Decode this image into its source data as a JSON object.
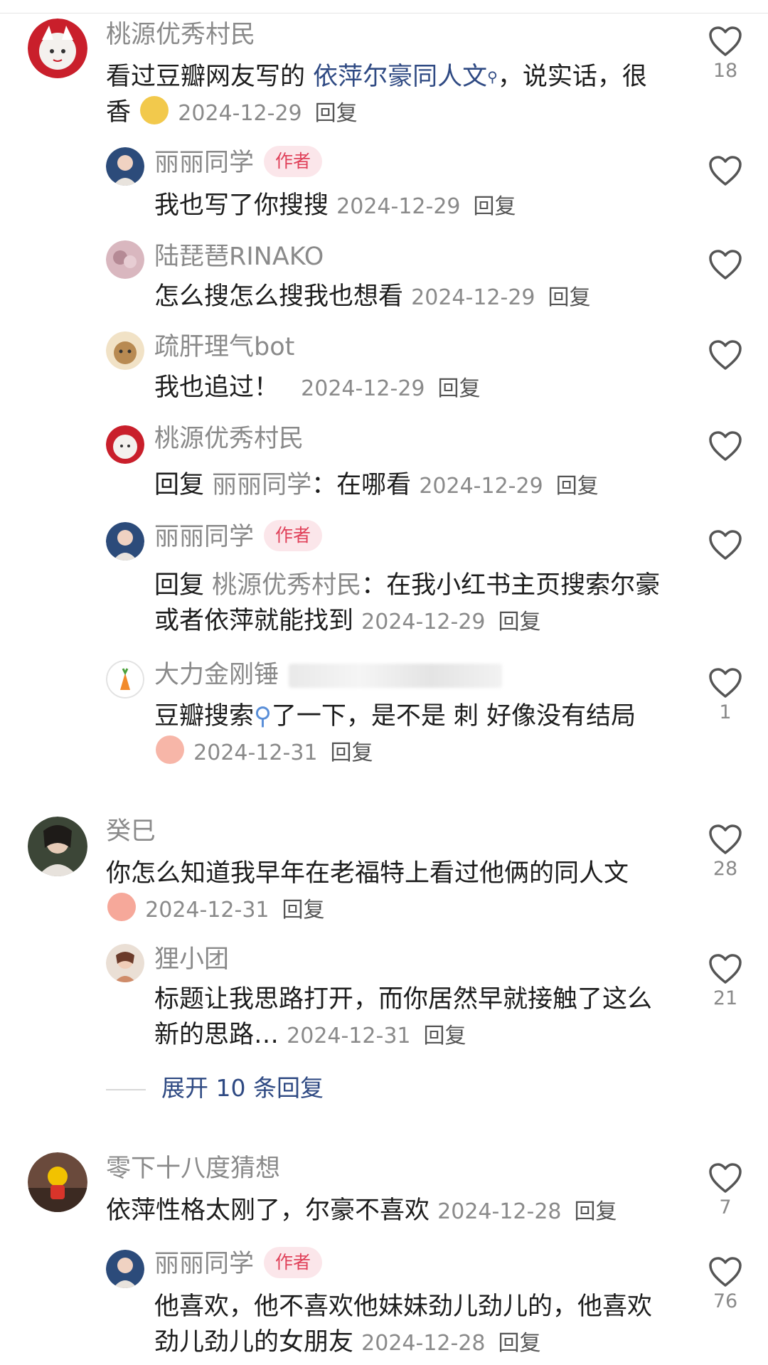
{
  "colors": {
    "author_badge_bg": "#fbe6ea",
    "author_badge_text": "#e0415a",
    "link": "#2f4a83",
    "meta": "#8a8a8a"
  },
  "icons": {
    "like": "heart-outline-icon",
    "search_keyword": "search-icon"
  },
  "comments": [
    {
      "user": "桃源优秀村民",
      "text_a": "看过豆瓣网友写的 ",
      "link": "依萍尔豪同人文",
      "text_b": "，说实话，很香",
      "date": "2024-12-29",
      "reply": "回复",
      "likes": "18"
    },
    {
      "user": "丽丽同学",
      "badge": "作者",
      "text": "我也写了你搜搜",
      "date": "2024-12-29",
      "reply": "回复",
      "likes": ""
    },
    {
      "user": "陆琵琶RINAKO",
      "text": "怎么搜怎么搜我也想看",
      "date": "2024-12-29",
      "reply": "回复",
      "likes": ""
    },
    {
      "user": "疏肝理气bot",
      "text": "我也追过！",
      "date": "2024-12-29",
      "reply": "回复",
      "likes": ""
    },
    {
      "user": "桃源优秀村民",
      "prefix": "回复",
      "to": "丽丽同学",
      "text": "：在哪看",
      "date": "2024-12-29",
      "reply": "回复",
      "likes": ""
    },
    {
      "user": "丽丽同学",
      "badge": "作者",
      "prefix": "回复",
      "to": "桃源优秀村民",
      "text": "：在我小红书主页搜索尔豪或者依萍就能找到",
      "date": "2024-12-29",
      "reply": "回复",
      "likes": ""
    },
    {
      "user": "大力金刚锤",
      "text_a": "豆瓣搜索",
      "text_b": "了一下，是不是 刺 好像没有结局",
      "date": "2024-12-31",
      "reply": "回复",
      "likes": "1"
    },
    {
      "user": "癸巳",
      "text": "你怎么知道我早年在老福特上看过他俩的同人文",
      "date": "2024-12-31",
      "reply": "回复",
      "likes": "28"
    },
    {
      "user": "狸小团",
      "text": "标题让我思路打开，而你居然早就接触了这么新的思路…",
      "date": "2024-12-31",
      "reply": "回复",
      "likes": "21"
    },
    {
      "user": "零下十八度猜想",
      "text": "依萍性格太刚了，尔豪不喜欢",
      "date": "2024-12-28",
      "reply": "回复",
      "likes": "7"
    },
    {
      "user": "丽丽同学",
      "badge": "作者",
      "text": "他喜欢，他不喜欢他妹妹劲儿劲儿的，他喜欢劲儿劲儿的女朋友",
      "date": "2024-12-28",
      "reply": "回复",
      "likes": "76"
    }
  ],
  "expand_label": "展开 10 条回复"
}
